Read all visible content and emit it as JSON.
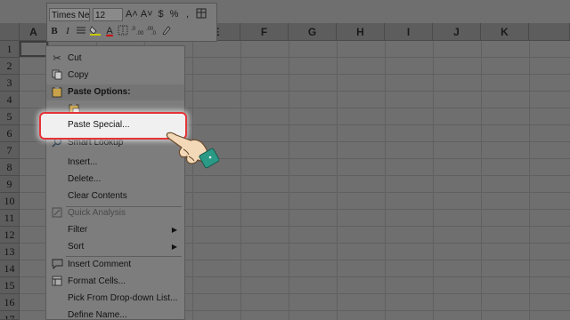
{
  "toolbar": {
    "font_name": "Times Ne",
    "font_size": "12",
    "grow_font": "A˄",
    "shrink_font": "A˅",
    "currency": "$",
    "percent": "%",
    "bold": "B",
    "italic": "I",
    "font_color": "A"
  },
  "columns": [
    "A",
    "B",
    "C",
    "D",
    "E",
    "F",
    "G",
    "H",
    "I",
    "J",
    "K"
  ],
  "rows": [
    "1",
    "2",
    "3",
    "4",
    "5",
    "6",
    "7",
    "8",
    "9",
    "10",
    "11",
    "12",
    "13",
    "14",
    "15",
    "16",
    "17",
    "18",
    "19"
  ],
  "context_menu": {
    "cut": "Cut",
    "copy": "Copy",
    "paste_options": "Paste Options:",
    "paste_special": "Paste Special...",
    "smart_lookup": "Smart Lookup",
    "insert": "Insert...",
    "delete": "Delete...",
    "clear_contents": "Clear Contents",
    "quick_analysis": "Quick Analysis",
    "filter": "Filter",
    "sort": "Sort",
    "insert_comment": "Insert Comment",
    "format_cells": "Format Cells...",
    "pick_from_list": "Pick From Drop-down List...",
    "define_name": "Define Name..."
  },
  "colors": {
    "highlight_border": "#e53238",
    "hand_cuff": "#2a9a86",
    "hand_skin": "#f3d9b8"
  }
}
